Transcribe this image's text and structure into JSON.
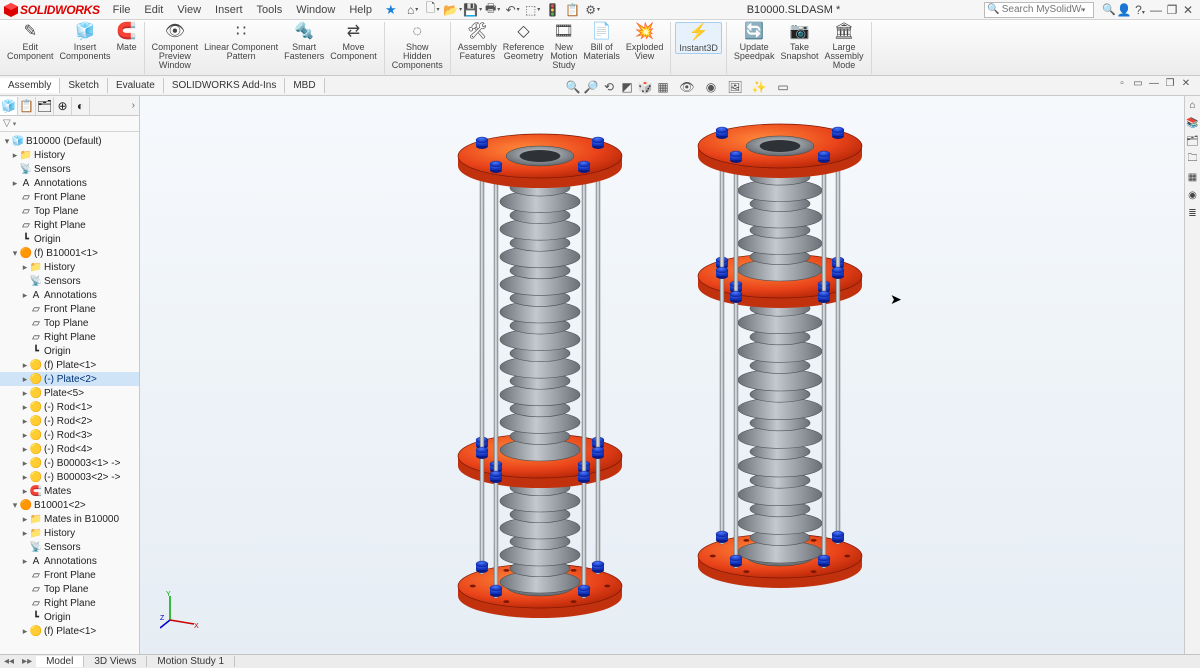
{
  "app": {
    "name": "SOLIDWORKS"
  },
  "menu": [
    "File",
    "Edit",
    "View",
    "Insert",
    "Tools",
    "Window",
    "Help"
  ],
  "document_title": "B10000.SLDASM *",
  "search_placeholder": "Search MySolidWorks",
  "ribbon": [
    {
      "label": "Edit\nComponent"
    },
    {
      "label": "Insert\nComponents"
    },
    {
      "label": "Mate"
    },
    {
      "label": "Component\nPreview\nWindow"
    },
    {
      "label": "Linear Component\nPattern"
    },
    {
      "label": "Smart\nFasteners"
    },
    {
      "label": "Move\nComponent"
    },
    {
      "label": "Show\nHidden\nComponents"
    },
    {
      "label": "Assembly\nFeatures"
    },
    {
      "label": "Reference\nGeometry"
    },
    {
      "label": "New\nMotion\nStudy"
    },
    {
      "label": "Bill of\nMaterials"
    },
    {
      "label": "Exploded\nView"
    },
    {
      "label": "Instant3D",
      "active": true
    },
    {
      "label": "Update\nSpeedpak"
    },
    {
      "label": "Take\nSnapshot"
    },
    {
      "label": "Large\nAssembly\nMode"
    }
  ],
  "tabs": [
    "Assembly",
    "Sketch",
    "Evaluate",
    "SOLIDWORKS Add-Ins",
    "MBD"
  ],
  "active_tab": 0,
  "tree_filter": "▼ ▾",
  "tree": [
    {
      "d": 0,
      "exp": "-",
      "ic": "assembly",
      "label": "B10000 (Default)"
    },
    {
      "d": 1,
      "exp": "+",
      "ic": "folder",
      "label": "History"
    },
    {
      "d": 1,
      "exp": "",
      "ic": "sensors",
      "label": "Sensors"
    },
    {
      "d": 1,
      "exp": "+",
      "ic": "ann",
      "label": "Annotations"
    },
    {
      "d": 1,
      "exp": "",
      "ic": "plane",
      "label": "Front Plane"
    },
    {
      "d": 1,
      "exp": "",
      "ic": "plane",
      "label": "Top Plane"
    },
    {
      "d": 1,
      "exp": "",
      "ic": "plane",
      "label": "Right Plane"
    },
    {
      "d": 1,
      "exp": "",
      "ic": "origin",
      "label": "Origin"
    },
    {
      "d": 1,
      "exp": "-",
      "ic": "subasm",
      "label": "(f) B10001<1>"
    },
    {
      "d": 2,
      "exp": "+",
      "ic": "folder",
      "label": "History"
    },
    {
      "d": 2,
      "exp": "",
      "ic": "sensors",
      "label": "Sensors"
    },
    {
      "d": 2,
      "exp": "+",
      "ic": "ann",
      "label": "Annotations"
    },
    {
      "d": 2,
      "exp": "",
      "ic": "plane",
      "label": "Front Plane"
    },
    {
      "d": 2,
      "exp": "",
      "ic": "plane",
      "label": "Top Plane"
    },
    {
      "d": 2,
      "exp": "",
      "ic": "plane",
      "label": "Right Plane"
    },
    {
      "d": 2,
      "exp": "",
      "ic": "origin",
      "label": "Origin"
    },
    {
      "d": 2,
      "exp": "+",
      "ic": "part",
      "label": "(f) Plate<1>"
    },
    {
      "d": 2,
      "exp": "+",
      "ic": "part",
      "label": "(-) Plate<2>",
      "sel": true
    },
    {
      "d": 2,
      "exp": "+",
      "ic": "part",
      "label": "Plate<5>"
    },
    {
      "d": 2,
      "exp": "+",
      "ic": "part",
      "label": "(-) Rod<1>"
    },
    {
      "d": 2,
      "exp": "+",
      "ic": "part",
      "label": "(-) Rod<2>"
    },
    {
      "d": 2,
      "exp": "+",
      "ic": "part",
      "label": "(-) Rod<3>"
    },
    {
      "d": 2,
      "exp": "+",
      "ic": "part",
      "label": "(-) Rod<4>"
    },
    {
      "d": 2,
      "exp": "+",
      "ic": "part",
      "label": "(-) B00003<1> ->"
    },
    {
      "d": 2,
      "exp": "+",
      "ic": "part",
      "label": "(-) B00003<2> ->"
    },
    {
      "d": 2,
      "exp": "+",
      "ic": "mates",
      "label": "Mates"
    },
    {
      "d": 1,
      "exp": "-",
      "ic": "subasm",
      "label": "B10001<2>"
    },
    {
      "d": 2,
      "exp": "+",
      "ic": "folder",
      "label": "Mates in B10000"
    },
    {
      "d": 2,
      "exp": "+",
      "ic": "folder",
      "label": "History"
    },
    {
      "d": 2,
      "exp": "",
      "ic": "sensors",
      "label": "Sensors"
    },
    {
      "d": 2,
      "exp": "+",
      "ic": "ann",
      "label": "Annotations"
    },
    {
      "d": 2,
      "exp": "",
      "ic": "plane",
      "label": "Front Plane"
    },
    {
      "d": 2,
      "exp": "",
      "ic": "plane",
      "label": "Top Plane"
    },
    {
      "d": 2,
      "exp": "",
      "ic": "plane",
      "label": "Right Plane"
    },
    {
      "d": 2,
      "exp": "",
      "ic": "origin",
      "label": "Origin"
    },
    {
      "d": 2,
      "exp": "+",
      "ic": "part",
      "label": "(f) Plate<1>"
    }
  ],
  "bottom_tabs": [
    "Model",
    "3D Views",
    "Motion Study 1"
  ],
  "active_bottom_tab": 0,
  "colors": {
    "brand_red": "#d2121f",
    "accent_blue": "#0f46c8",
    "steel_light": "#b7bfc6",
    "steel_dark": "#7f878e",
    "bellow_light": "#a8afb6",
    "bellow_dark": "#6d7379",
    "flange_light": "#f96a22",
    "flange_dark": "#d0330d"
  }
}
